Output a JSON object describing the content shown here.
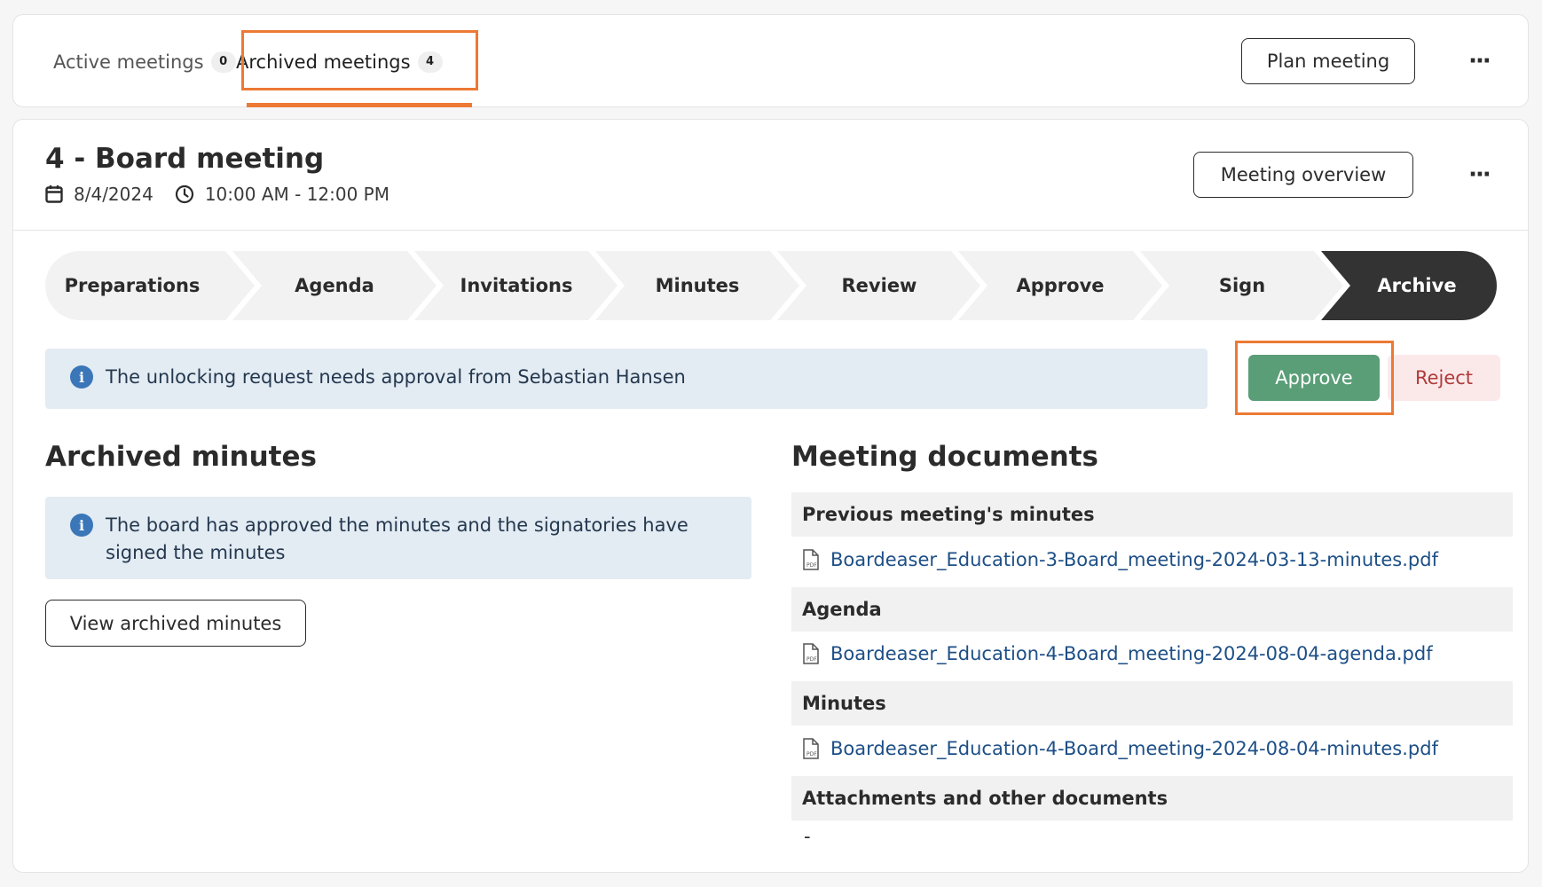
{
  "tabs": {
    "active": {
      "label": "Active meetings",
      "count": "0"
    },
    "archived": {
      "label": "Archived meetings",
      "count": "4"
    }
  },
  "header_actions": {
    "plan_meeting": "Plan meeting",
    "more": "···"
  },
  "meeting": {
    "title": "4 - Board meeting",
    "date": "8/4/2024",
    "time": "10:00 AM - 12:00 PM",
    "overview_button": "Meeting overview",
    "more": "···"
  },
  "stepper": {
    "steps": [
      "Preparations",
      "Agenda",
      "Invitations",
      "Minutes",
      "Review",
      "Approve",
      "Sign",
      "Archive"
    ],
    "current": "Archive",
    "colors": {
      "step": "#f2f2f2",
      "current": "#333333"
    }
  },
  "unlock_request": {
    "message": "The unlocking request needs approval from Sebastian Hansen",
    "approve": "Approve",
    "reject": "Reject"
  },
  "archived_minutes": {
    "title": "Archived minutes",
    "notice": "The board has approved the minutes and the signatories have signed the minutes",
    "view_button": "View archived minutes"
  },
  "documents": {
    "title": "Meeting documents",
    "sections": [
      {
        "heading": "Previous meeting's minutes",
        "file": "Boardeaser_Education-3-Board_meeting-2024-03-13-minutes.pdf"
      },
      {
        "heading": "Agenda",
        "file": "Boardeaser_Education-4-Board_meeting-2024-08-04-agenda.pdf"
      },
      {
        "heading": "Minutes",
        "file": "Boardeaser_Education-4-Board_meeting-2024-08-04-minutes.pdf"
      },
      {
        "heading": "Attachments and other documents",
        "file": "-"
      }
    ]
  },
  "colors": {
    "accent": "#ec7a34",
    "approve": "#5a9e78",
    "reject_bg": "#fbe9ea",
    "reject_text": "#b03a3a",
    "info_bg": "#e3ebf3",
    "link": "#1d4f86"
  }
}
